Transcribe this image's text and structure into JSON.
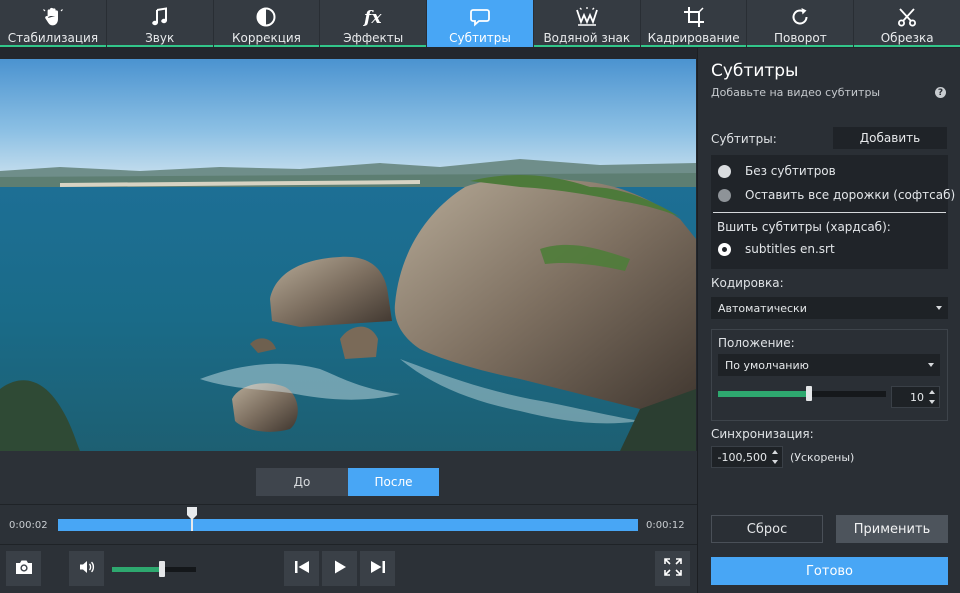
{
  "toolbar": {
    "tabs": [
      {
        "label": "Стабилизация",
        "icon": "hand-icon"
      },
      {
        "label": "Звук",
        "icon": "music-note-icon"
      },
      {
        "label": "Коррекция",
        "icon": "contrast-icon"
      },
      {
        "label": "Эффекты",
        "icon": "fx-icon"
      },
      {
        "label": "Субтитры",
        "icon": "speech-bubble-icon",
        "active": true
      },
      {
        "label": "Водяной знак",
        "icon": "watermark-icon"
      },
      {
        "label": "Кадрирование",
        "icon": "crop-icon"
      },
      {
        "label": "Поворот",
        "icon": "rotate-icon"
      },
      {
        "label": "Обрезка",
        "icon": "scissors-icon"
      }
    ],
    "fx_glyph": "fx",
    "active_color": "#48a6f5",
    "underline_color": "#32c68a"
  },
  "preview": {
    "before_label": "До",
    "after_label": "После",
    "active_compare": "after"
  },
  "timeline": {
    "current_time": "0:00:02",
    "total_time": "0:00:12",
    "progress": 0.23
  },
  "controls": {
    "snapshot_icon": "camera-icon",
    "volume_icon": "speaker-icon",
    "volume_level": 0.6,
    "prev_icon": "skip-back-icon",
    "play_icon": "play-icon",
    "next_icon": "skip-forward-icon",
    "fullscreen_icon": "fullscreen-icon"
  },
  "panel": {
    "title": "Субтитры",
    "subtitle": "Добавьте на видео субтитры",
    "help_glyph": "?",
    "subs_label": "Субтитры:",
    "add_button": "Добавить",
    "options": {
      "none": "Без субтитров",
      "keep_all": "Оставить все дорожки (софтсаб)",
      "burn_header": "Вшить субтитры (хардсаб):",
      "file": "subtitles en.srt"
    },
    "selected_option": "file",
    "encoding_label": "Кодировка:",
    "encoding_value": "Автоматически",
    "position_label": "Положение:",
    "position_value": "По умолчанию",
    "position_slider_value": 0.54,
    "position_number": "10",
    "sync_label": "Синхронизация:",
    "sync_value": "-100,500",
    "sync_hint": "(Ускорены)",
    "reset_button": "Сброс",
    "apply_button": "Применить",
    "done_button": "Готово"
  }
}
